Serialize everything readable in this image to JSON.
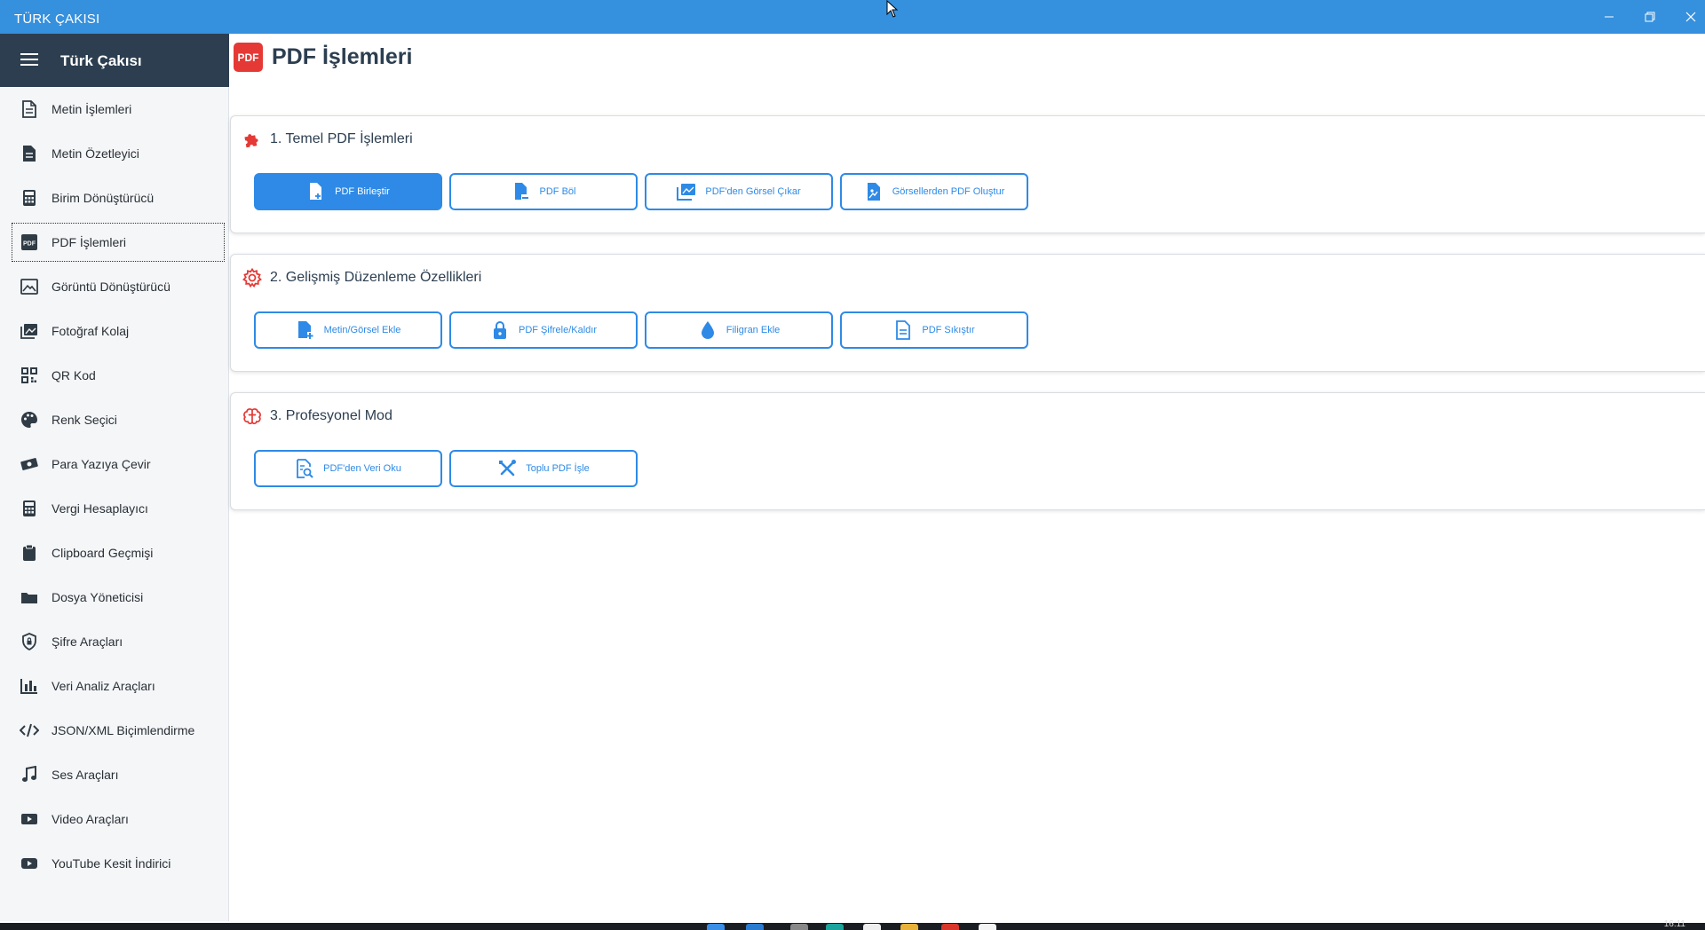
{
  "window": {
    "title": "TÜRK ÇAKISI"
  },
  "sidebar": {
    "title": "Türk Çakısı",
    "items": [
      {
        "label": "Metin İşlemleri",
        "icon": "document-text-icon"
      },
      {
        "label": "Metin Özetleyici",
        "icon": "document-lines-icon"
      },
      {
        "label": "Birim Dönüştürücü",
        "icon": "calculator-icon"
      },
      {
        "label": "PDF İşlemleri",
        "icon": "pdf-icon"
      },
      {
        "label": "Görüntü Dönüştürücü",
        "icon": "image-icon"
      },
      {
        "label": "Fotoğraf Kolaj",
        "icon": "photo-collage-icon"
      },
      {
        "label": "QR Kod",
        "icon": "qr-code-icon"
      },
      {
        "label": "Renk Seçici",
        "icon": "palette-icon"
      },
      {
        "label": "Para Yazıya Çevir",
        "icon": "money-icon"
      },
      {
        "label": "Vergi Hesaplayıcı",
        "icon": "calculator-icon"
      },
      {
        "label": "Clipboard Geçmişi",
        "icon": "clipboard-icon"
      },
      {
        "label": "Dosya Yöneticisi",
        "icon": "folder-icon"
      },
      {
        "label": "Şifre Araçları",
        "icon": "shield-lock-icon"
      },
      {
        "label": "Veri Analiz Araçları",
        "icon": "bar-chart-icon"
      },
      {
        "label": "JSON/XML Biçimlendirme",
        "icon": "code-icon"
      },
      {
        "label": "Ses Araçları",
        "icon": "music-note-icon"
      },
      {
        "label": "Video Araçları",
        "icon": "video-camera-icon"
      },
      {
        "label": "YouTube Kesit İndirici",
        "icon": "youtube-icon"
      }
    ],
    "active_index": 3
  },
  "main": {
    "badge": "PDF",
    "title": "PDF İşlemleri",
    "sections": [
      {
        "title": "1. Temel PDF İşlemleri",
        "icon": "puzzle-icon",
        "buttons": [
          {
            "label": "PDF Birleştir",
            "icon": "file-add-icon",
            "primary": true
          },
          {
            "label": "PDF Böl",
            "icon": "file-minus-icon"
          },
          {
            "label": "PDF'den Görsel Çıkar",
            "icon": "images-icon"
          },
          {
            "label": "Görsellerden PDF Oluştur",
            "icon": "file-image-icon"
          }
        ]
      },
      {
        "title": "2. Gelişmiş Düzenleme Özellikleri",
        "icon": "gear-icon",
        "buttons": [
          {
            "label": "Metin/Görsel Ekle",
            "icon": "file-plus-icon"
          },
          {
            "label": "PDF Şifrele/Kaldır",
            "icon": "lock-icon"
          },
          {
            "label": "Filigran Ekle",
            "icon": "water-drop-icon"
          },
          {
            "label": "PDF Sıkıştır",
            "icon": "file-lines-icon"
          }
        ]
      },
      {
        "title": "3. Profesyonel Mod",
        "icon": "brain-icon",
        "buttons": [
          {
            "label": "PDF'den Veri Oku",
            "icon": "file-search-icon"
          },
          {
            "label": "Toplu PDF İşle",
            "icon": "tools-icon"
          }
        ]
      }
    ]
  },
  "taskbar": {
    "clock": "16:11"
  },
  "colors": {
    "titlebar": "#3590de",
    "sidebar_header": "#2c3e50",
    "accent": "#2e8ae6",
    "section_icon": "#e53935"
  }
}
